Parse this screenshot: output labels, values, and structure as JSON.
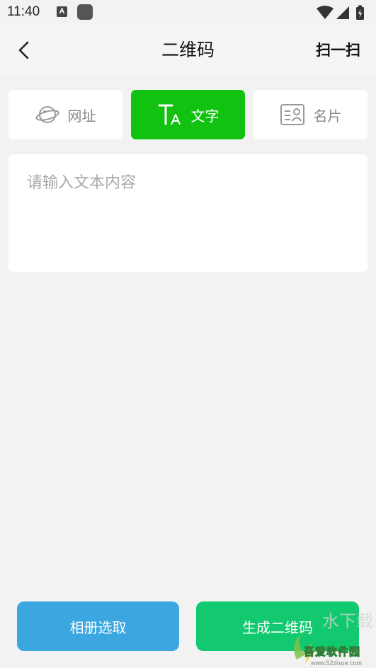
{
  "status_bar": {
    "time": "11:40",
    "notification_glyph": "A",
    "icons": [
      "wifi-icon",
      "signal-icon",
      "battery-charging-icon"
    ]
  },
  "header": {
    "title": "二维码",
    "scan_label": "扫一扫"
  },
  "tabs": [
    {
      "label": "网址",
      "icon": "planet-icon",
      "active": false
    },
    {
      "label": "文字",
      "icon": "text-icon",
      "active": true
    },
    {
      "label": "名片",
      "icon": "id-card-icon",
      "active": false
    }
  ],
  "text_input": {
    "placeholder": "请输入文本内容",
    "value": ""
  },
  "buttons": {
    "album_label": "相册选取",
    "generate_label": "生成二维码"
  },
  "watermark": {
    "text": "吾爱软件园",
    "sub": "www.52zixue.com"
  },
  "colors": {
    "active_tab": "#11c210",
    "album_button": "#3ba6e0",
    "generate_button": "#13c96f",
    "background": "#f2f2f2"
  }
}
